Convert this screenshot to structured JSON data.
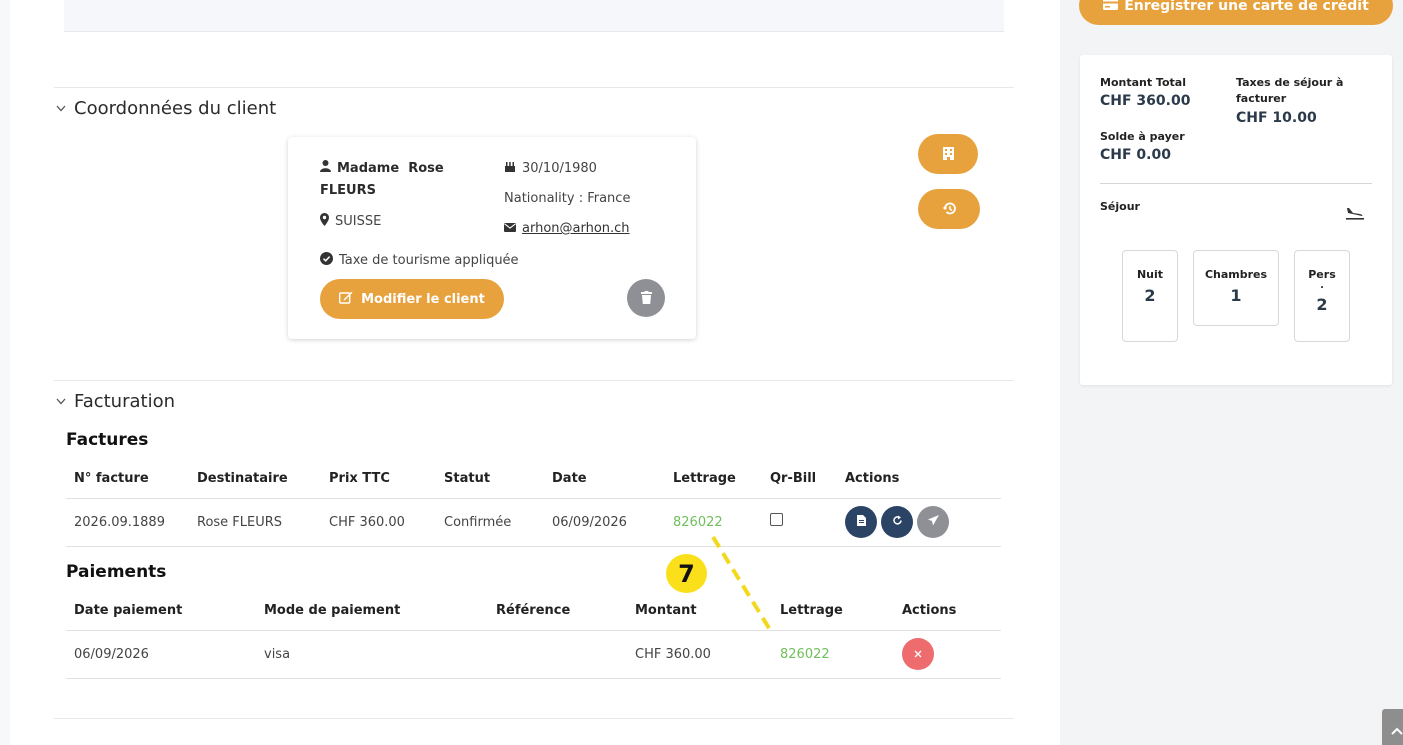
{
  "sections": {
    "client_title": "Coordonnées du client",
    "billing_title": "Facturation"
  },
  "client": {
    "name_line1": "Madame  Rose",
    "name_line2": "FLEURS",
    "country": "SUISSE",
    "birthdate": "30/10/1980",
    "nationality": "Nationality : France",
    "email": "arhon@arhon.ch",
    "tourism_tax": "Taxe de tourisme appliquée",
    "edit_label": "Modifier le client"
  },
  "invoices": {
    "title": "Factures",
    "headers": [
      "N° facture",
      "Destinataire",
      "Prix TTC",
      "Statut",
      "Date",
      "Lettrage",
      "Qr-Bill",
      "Actions"
    ],
    "rows": [
      {
        "number": "2026.09.1889",
        "recipient": "Rose FLEURS",
        "price": "CHF 360.00",
        "status": "Confirmée",
        "date": "06/09/2026",
        "lettering": "826022"
      }
    ]
  },
  "payments": {
    "title": "Paiements",
    "headers": [
      "Date paiement",
      "Mode de paiement",
      "Référence",
      "Montant",
      "Lettrage",
      "Actions"
    ],
    "rows": [
      {
        "date": "06/09/2026",
        "mode": "visa",
        "reference": "",
        "amount": "CHF 360.00",
        "lettering": "826022"
      }
    ]
  },
  "annotation": {
    "number": "7"
  },
  "sidebar": {
    "register_card_label": "Enregistrer une carte de crédit",
    "total_label": "Montant Total",
    "total_value": "CHF 360.00",
    "tax_label": "Taxes de séjour à facturer",
    "tax_value": "CHF 10.00",
    "balance_label": "Solde à payer",
    "balance_value": "CHF 0.00",
    "stay_label": "Séjour",
    "nights_label": "Nuit",
    "nights_value": "2",
    "rooms_label": "Chambres",
    "rooms_value": "1",
    "persons_label": "Pers",
    "persons_dot": ".",
    "persons_value": "2"
  },
  "colors": {
    "accent": "#e8a23d",
    "navy": "#2b4466",
    "grey": "#8e9096",
    "danger": "#ee6b6e",
    "link_green": "#6fbf5a",
    "marker_yellow": "#f9e01b"
  }
}
